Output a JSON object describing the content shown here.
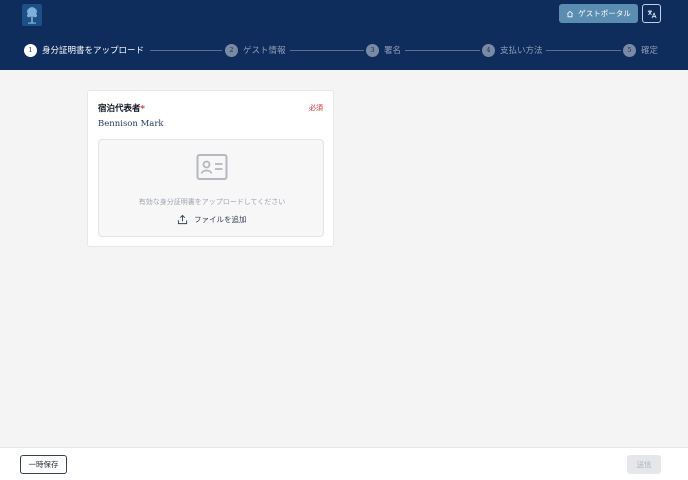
{
  "header": {
    "portal_label": "ゲストポータル",
    "portal_icon": "home-icon",
    "language_icon": "translate-icon"
  },
  "stepper": {
    "steps": [
      {
        "number": "1",
        "label": "身分証明書をアップロード",
        "state": "active"
      },
      {
        "number": "2",
        "label": "ゲスト情報",
        "state": "inactive"
      },
      {
        "number": "3",
        "label": "署名",
        "state": "inactive"
      },
      {
        "number": "4",
        "label": "支払い方法",
        "state": "inactive"
      },
      {
        "number": "5",
        "label": "確定",
        "state": "inactive"
      }
    ]
  },
  "card": {
    "title": "宿泊代表者",
    "required_mark": "*",
    "required_badge": "必須",
    "guest_name": "Bennison Mark",
    "upload_icon": "id-card-icon",
    "upload_hint": "有効な身分証明書をアップロードしてください",
    "add_file_icon": "upload-icon",
    "add_file_label": "ファイルを追加"
  },
  "footer": {
    "save_label": "一時保存",
    "submit_label": "送信"
  },
  "colors": {
    "header_bg": "#0f2d5c",
    "portal_button": "#5b8db1",
    "required": "#dc2626"
  }
}
